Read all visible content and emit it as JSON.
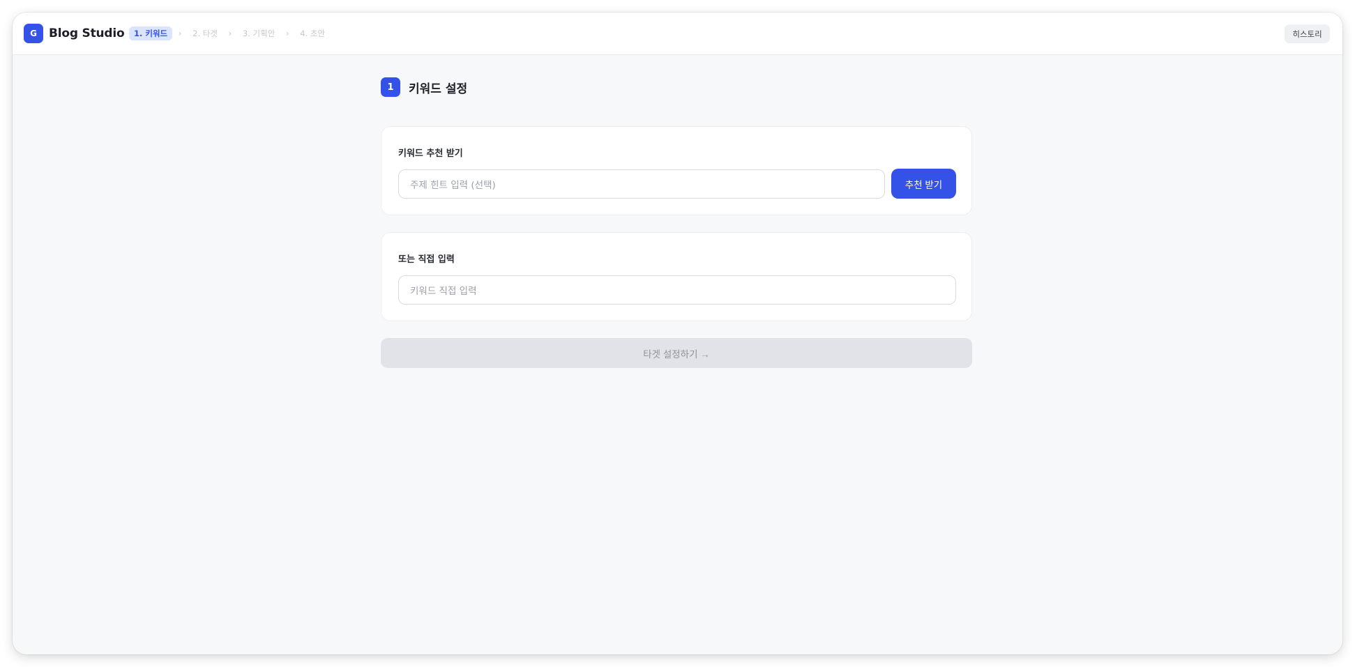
{
  "app": {
    "logo_letter": "G",
    "title": "Blog Studio"
  },
  "steps": [
    {
      "label": "1. 키워드",
      "active": true
    },
    {
      "label": "2. 타겟",
      "active": false
    },
    {
      "label": "3. 기획안",
      "active": false
    },
    {
      "label": "4. 초안",
      "active": false
    }
  ],
  "step_separator": "›",
  "header": {
    "history_label": "히스토리"
  },
  "section": {
    "number": "1",
    "title": "키워드 설정"
  },
  "recommend_card": {
    "label": "키워드 추천 받기",
    "input_placeholder": "주제 힌트 입력 (선택)",
    "button_label": "추천 받기"
  },
  "manual_card": {
    "label": "또는 직접 입력",
    "input_placeholder": "키워드 직접 입력"
  },
  "next_button_label": "타겟 설정하기 →",
  "colors": {
    "accent": "#3452e8",
    "active_step_bg": "#dbe4ff",
    "disabled_bg": "#e1e3e8"
  }
}
